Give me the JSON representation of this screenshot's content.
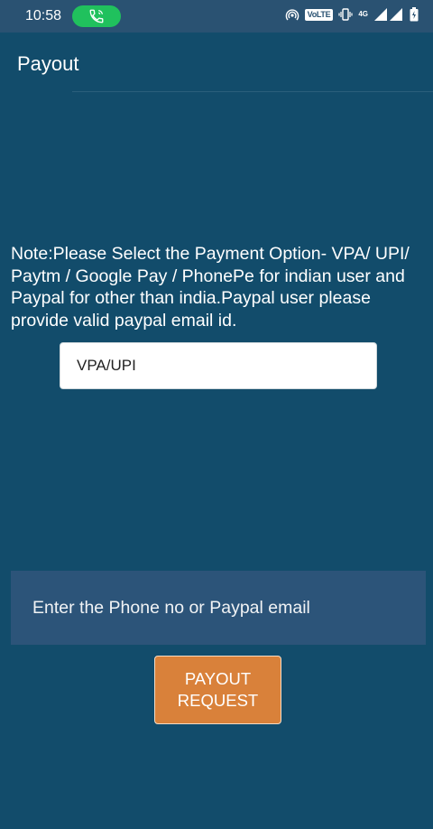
{
  "status_bar": {
    "time": "10:58",
    "network_label": "VoLTE",
    "network_type": "4G",
    "icons": [
      "phone-call-icon",
      "hotspot-icon",
      "vibrate-icon",
      "signal-icon",
      "battery-icon"
    ]
  },
  "header": {
    "title": "Payout"
  },
  "note": {
    "text": "Note:Please Select the Payment Option- VPA/ UPI/ Paytm / Google Pay / PhonePe for indian user and Paypal for other than india.Paypal user please provide valid paypal email id."
  },
  "payment_select": {
    "selected": "VPA/UPI"
  },
  "contact_input": {
    "value": "",
    "placeholder": "Enter the Phone no or Paypal email"
  },
  "payout_button": {
    "line1": "PAYOUT",
    "line2": "REQUEST"
  },
  "colors": {
    "background": "#124c6b",
    "status_bar": "#2a5272",
    "input_bg": "#2c5479",
    "button": "#d9813a",
    "call_pill": "#20c15d"
  }
}
